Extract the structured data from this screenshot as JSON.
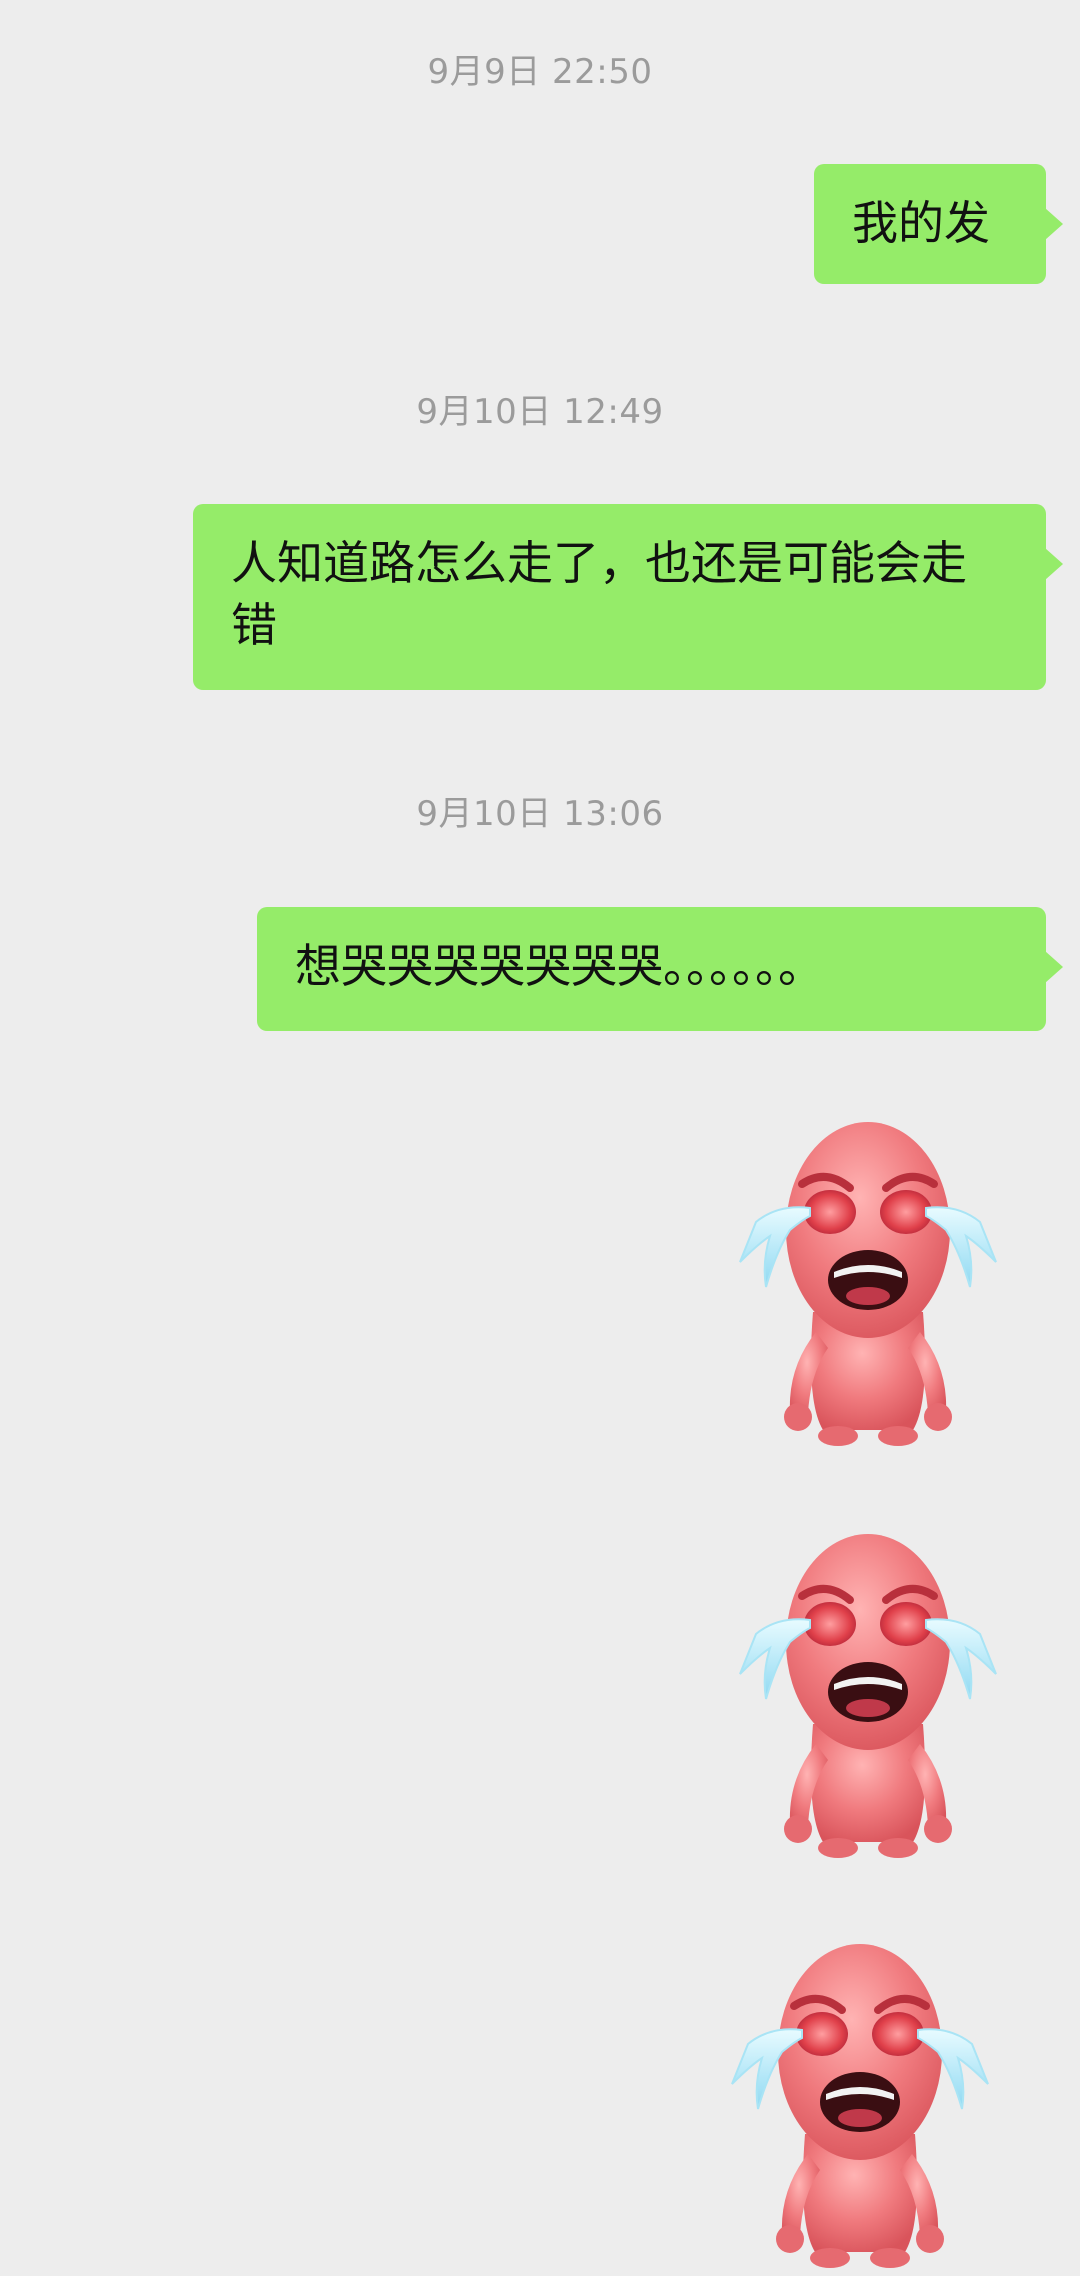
{
  "chat": {
    "messages": [
      {
        "type": "timestamp",
        "text": "9月9日 22:50"
      },
      {
        "type": "text",
        "sender": "self",
        "text": "我的发"
      },
      {
        "type": "timestamp",
        "text": "9月10日 12:49"
      },
      {
        "type": "text",
        "sender": "self",
        "text": "人知道路怎么走了，也还是可能会走错"
      },
      {
        "type": "timestamp",
        "text": "9月10日 13:06"
      },
      {
        "type": "text",
        "sender": "self",
        "text": "想哭哭哭哭哭哭哭。。。。。。"
      },
      {
        "type": "sticker",
        "sender": "self",
        "icon": "crying-pink-character-icon"
      },
      {
        "type": "sticker",
        "sender": "self",
        "icon": "crying-pink-character-icon"
      },
      {
        "type": "sticker",
        "sender": "self",
        "icon": "crying-pink-character-icon"
      }
    ]
  },
  "colors": {
    "background": "#ededed",
    "bubble_self": "#95ec69",
    "timestamp_text": "#9b9b9b",
    "message_text": "#111111"
  }
}
